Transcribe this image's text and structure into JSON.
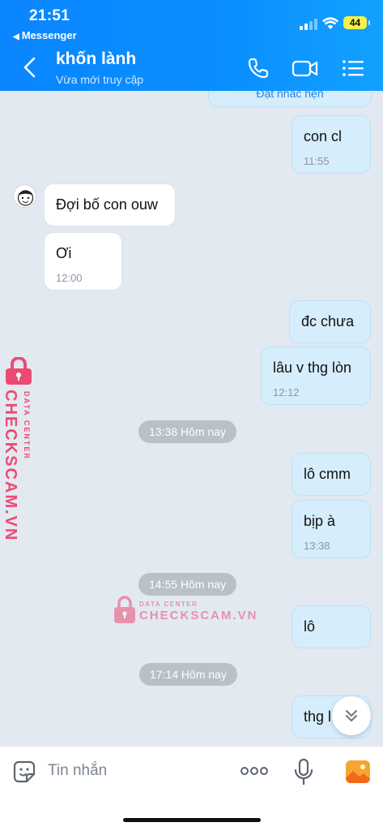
{
  "status_bar": {
    "time": "21:51",
    "back_app": "Messenger",
    "battery": "44"
  },
  "header": {
    "contact_name": "khốn lành",
    "contact_status": "Vừa mới truy cập"
  },
  "reminder_label": "Đặt nhắc hẹn",
  "messages": [
    {
      "dir": "out",
      "text": "con cl",
      "time": "11:55"
    },
    {
      "dir": "in",
      "text": "Đợi bố con ouw"
    },
    {
      "dir": "in",
      "text": "Ơi",
      "time": "12:00"
    },
    {
      "dir": "out",
      "text": "đc chưa"
    },
    {
      "dir": "out",
      "text": "lâu v thg lòn",
      "time": "12:12"
    },
    {
      "dir": "out",
      "text": "lô cmm"
    },
    {
      "dir": "out",
      "text": "bịp à",
      "time": "13:38"
    },
    {
      "dir": "out",
      "text": "lô"
    },
    {
      "dir": "out",
      "text": "thg l"
    }
  ],
  "separators": [
    "13:38 Hôm nay",
    "14:55 Hôm nay",
    "17:14 Hôm nay"
  ],
  "watermark": {
    "brand": "CHECKSCAM.VN",
    "subtitle": "DATA CENTER"
  },
  "input": {
    "placeholder": "Tin nhắn"
  },
  "colors": {
    "header": "#0a8fff",
    "bubble_out": "#d6edfb",
    "bubble_in": "#ffffff",
    "watermark": "#ec4a73",
    "background": "#e2e9f1"
  },
  "icons": {
    "header": [
      "chevron-left-icon",
      "phone-icon",
      "video-camera-icon",
      "list-menu-icon"
    ],
    "input": [
      "sticker-icon",
      "more-options-icon",
      "microphone-icon",
      "image-gallery-icon"
    ]
  }
}
